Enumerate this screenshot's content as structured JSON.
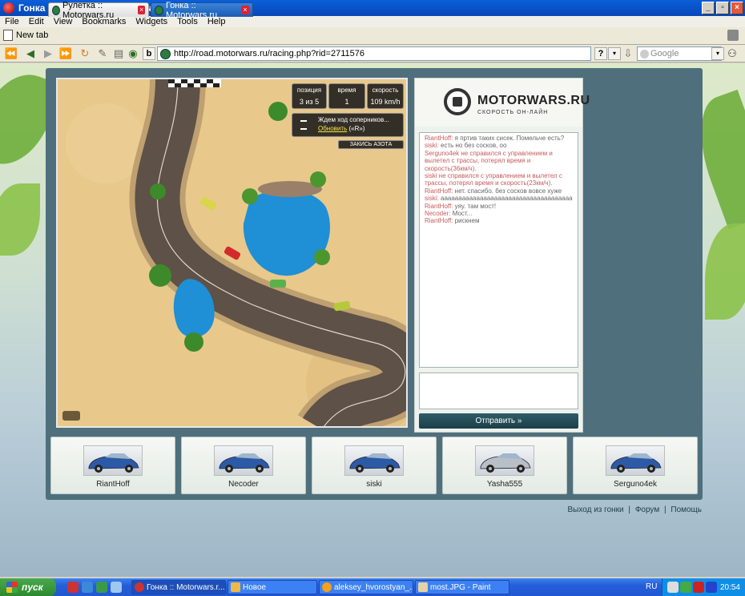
{
  "window": {
    "title": "Гонка :: Motorwars.ru - Opera"
  },
  "menu": [
    "File",
    "Edit",
    "View",
    "Bookmarks",
    "Widgets",
    "Tools",
    "Help"
  ],
  "tabs": {
    "new_tab": "New tab",
    "items": [
      {
        "label": "Рулетка :: Motorwars.ru",
        "active": false
      },
      {
        "label": "Гонка :: Motorwars.ru",
        "active": true
      }
    ]
  },
  "nav": {
    "url": "http://road.motorwars.ru/racing.php?rid=2711576",
    "search_placeholder": "Google"
  },
  "game": {
    "hud": {
      "position_label": "позиция",
      "position_value": "3 из 5",
      "time_label": "время",
      "time_value": "1",
      "speed_label": "скорость",
      "speed_value": "109 km/h"
    },
    "waiting_text": "Ждем ход соперников...",
    "refresh_link": "Обновить",
    "refresh_hotkey": "(«R»)",
    "nitro_button": "ЗАКИСЬ АЗОТА",
    "colors": {
      "sand": "#e8c98b",
      "road": "#5e5147",
      "water": "#1f8fd6"
    }
  },
  "sidebar": {
    "logo_text": "MOTORWARS.RU",
    "logo_subtitle": "СКОРОСТЬ ОН-ЛАЙН",
    "send_button": "Отправить »",
    "chat": [
      {
        "nick": "RiantHoff:",
        "text": " я пртив таких сисек. Помельче есть?",
        "type": "msg"
      },
      {
        "nick": "siski:",
        "text": " есть но без сосков,   oo",
        "type": "msg"
      },
      {
        "nick": "",
        "text": "Serguno4ek не справился с управлением и вылетел с трассы, потерял время и скорость(36км/ч).",
        "type": "sys"
      },
      {
        "nick": "",
        "text": "siski не справился с управлением и вылетел с трассы, потерял время и скорость(23км/ч).",
        "type": "sys"
      },
      {
        "nick": "RiantHoff:",
        "text": " нет. спасибо. без сосков вовсе хуже",
        "type": "msg"
      },
      {
        "nick": "siski:",
        "text": " ааааааааааааааааааааааааааааааааааааа",
        "type": "msg"
      },
      {
        "nick": "RiantHoff:",
        "text": " уяу. там мост!",
        "type": "msg"
      },
      {
        "nick": "Necoder:",
        "text": " Мост...",
        "type": "msg"
      },
      {
        "nick": "RiantHoff:",
        "text": " рискнем",
        "type": "msg"
      }
    ]
  },
  "players": [
    {
      "name": "RiantHoff",
      "car_color": "#2d5aa6"
    },
    {
      "name": "Necoder",
      "car_color": "#2d5aa6"
    },
    {
      "name": "siski",
      "car_color": "#2d5aa6"
    },
    {
      "name": "Yasha555",
      "car_color": "#b9bfc6"
    },
    {
      "name": "Serguno4ek",
      "car_color": "#2d5aa6"
    }
  ],
  "footer": {
    "exit": "Выход из гонки",
    "forum": "Форум",
    "help": "Помощь",
    "sep": "|"
  },
  "taskbar": {
    "start": "пуск",
    "buttons": [
      {
        "label": "Гонка :: Motorwars.r...",
        "active": true
      },
      {
        "label": "Новое",
        "active": false
      },
      {
        "label": "aleksey_hvorostyan_...",
        "active": false
      },
      {
        "label": "most.JPG - Paint",
        "active": false
      }
    ],
    "lang": "RU",
    "clock": "20:54"
  }
}
